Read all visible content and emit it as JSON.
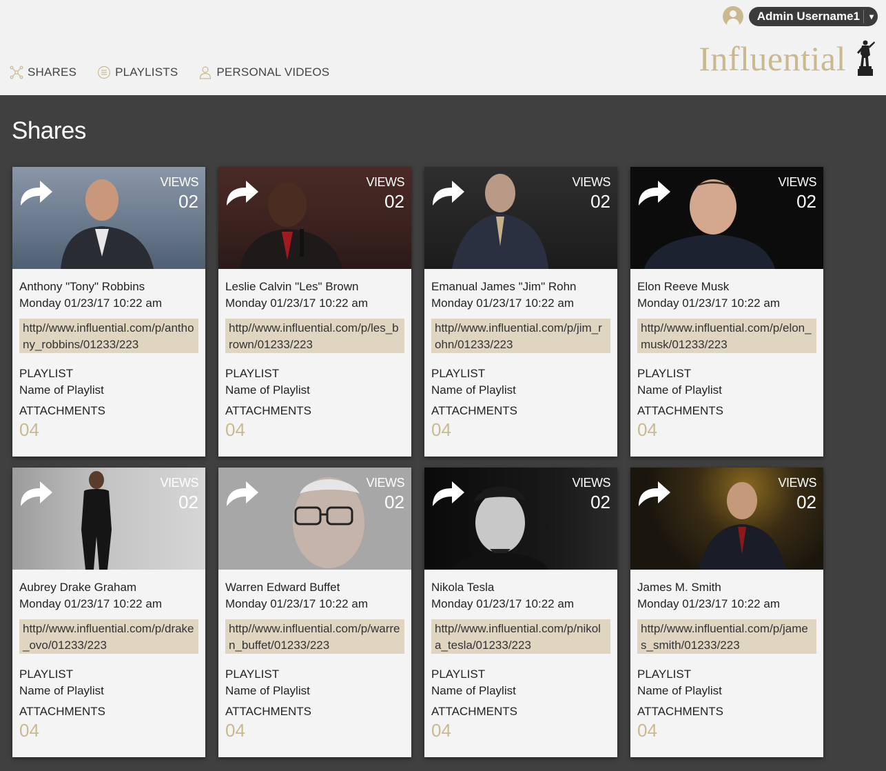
{
  "header": {
    "username": "Admin Username1",
    "nav": [
      {
        "label": "SHARES",
        "icon": "shares-icon"
      },
      {
        "label": "PLAYLISTS",
        "icon": "playlist-icon"
      },
      {
        "label": "PERSONAL VIDEOS",
        "icon": "person-icon"
      }
    ],
    "logo_text": "Influential"
  },
  "main": {
    "title": "Shares",
    "views_label": "VIEWS",
    "playlist_label": "PLAYLIST",
    "attachments_label": "ATTACHMENTS",
    "cards": [
      {
        "name": "Anthony \"Tony\" Robbins",
        "date": "Monday 01/23/17 10:22 am",
        "url": "http//www.influential.com/p/anthony_robbins/01233/223",
        "views": "02",
        "playlist": "Name of Playlist",
        "attachments": "04"
      },
      {
        "name": "Leslie Calvin \"Les\" Brown",
        "date": "Monday 01/23/17 10:22 am",
        "url": "http//www.influential.com/p/les_brown/01233/223",
        "views": "02",
        "playlist": "Name of Playlist",
        "attachments": "04"
      },
      {
        "name": "Emanual James \"Jim\" Rohn",
        "date": "Monday 01/23/17 10:22 am",
        "url": "http//www.influential.com/p/jim_rohn/01233/223",
        "views": "02",
        "playlist": "Name of Playlist",
        "attachments": "04"
      },
      {
        "name": "Elon Reeve Musk",
        "date": "Monday 01/23/17 10:22 am",
        "url": "http//www.influential.com/p/elon_musk/01233/223",
        "views": "02",
        "playlist": "Name of Playlist",
        "attachments": "04"
      },
      {
        "name": "Aubrey Drake Graham",
        "date": "Monday 01/23/17 10:22 am",
        "url": "http//www.influential.com/p/drake_ovo/01233/223",
        "views": "02",
        "playlist": "Name of Playlist",
        "attachments": "04"
      },
      {
        "name": "Warren Edward Buffet",
        "date": "Monday 01/23/17 10:22 am",
        "url": "http//www.influential.com/p/warren_buffet/01233/223",
        "views": "02",
        "playlist": "Name of Playlist",
        "attachments": "04"
      },
      {
        "name": "Nikola Tesla",
        "date": "Monday 01/23/17 10:22 am",
        "url": "http//www.influential.com/p/nikola_tesla/01233/223",
        "views": "02",
        "playlist": "Name of Playlist",
        "attachments": "04"
      },
      {
        "name": "James M. Smith",
        "date": "Monday 01/23/17 10:22 am",
        "url": "http//www.influential.com/p/james_smith/01233/223",
        "views": "02",
        "playlist": "Name of Playlist",
        "attachments": "04"
      }
    ]
  },
  "colors": {
    "accent": "#c8b98f",
    "url_bg": "#e0d5c1",
    "main_bg": "#404040",
    "header_bg": "#f3f2f2"
  }
}
